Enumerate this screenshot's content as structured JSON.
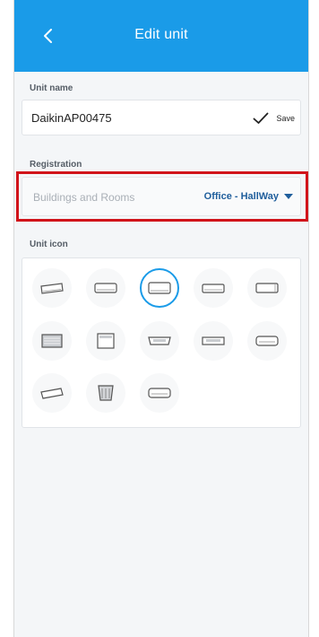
{
  "header": {
    "title": "Edit unit"
  },
  "unit_name": {
    "label": "Unit name",
    "value": "DaikinAP00475",
    "save_label": "Save"
  },
  "registration": {
    "label": "Registration",
    "placeholder": "Buildings and Rooms",
    "selected": "Office - HallWay"
  },
  "unit_icon": {
    "label": "Unit icon",
    "selected_index": 2,
    "icons": [
      "wall-unit-slim-icon",
      "wall-unit-icon",
      "wall-unit-icon",
      "wall-unit-icon",
      "wall-unit-icon",
      "cassette-unit-icon",
      "window-unit-icon",
      "ceiling-unit-icon",
      "ceiling-unit-icon",
      "duct-unit-icon",
      "wall-unit-slim-icon",
      "floor-unit-icon",
      "duct-unit-icon"
    ]
  },
  "colors": {
    "header_bg": "#1a9be8",
    "accent": "#1a9be8",
    "highlight_outline": "#d1131a",
    "selected_value": "#1f5e9c"
  }
}
